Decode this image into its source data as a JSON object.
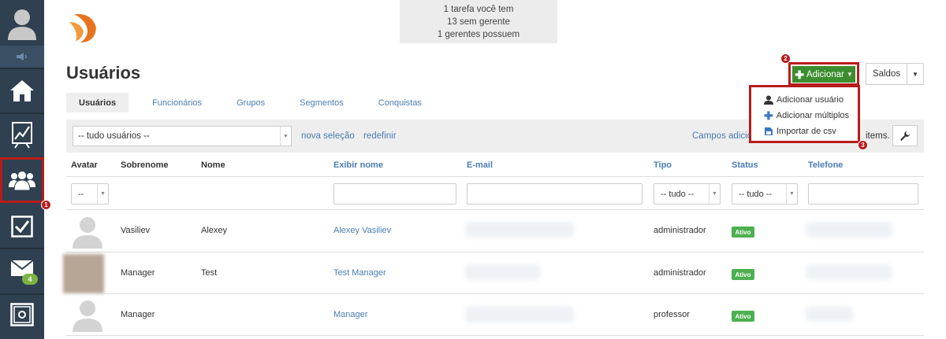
{
  "notification": {
    "line1": "1 tarefa você tem",
    "line2": "13 sem gerente",
    "line3": "1 gerentes possuem"
  },
  "page": {
    "title": "Usuários"
  },
  "toolbar": {
    "add_label": "Adicionar",
    "saldos_label": "Saldos"
  },
  "dropdown": {
    "items": [
      {
        "label": "Adicionar usuário",
        "icon": "user-icon"
      },
      {
        "label": "Adicionar múltiplos",
        "icon": "plus-icon"
      },
      {
        "label": "Importar de csv",
        "icon": "csv-import-icon"
      }
    ]
  },
  "tabs": [
    "Usuários",
    "Funcionários",
    "Grupos",
    "Segmentos",
    "Conquistas"
  ],
  "filterbar": {
    "selection": "-- tudo usuários --",
    "new_selection": "nova seleção",
    "reset": "redefinir",
    "custom_fields": "Campos adicio",
    "items": "items."
  },
  "table": {
    "headers": [
      "Avatar",
      "Sobrenome",
      "Nome",
      "Exibir nome",
      "E-mail",
      "Tipo",
      "Status",
      "Telefone"
    ],
    "filters": {
      "avatar": "--",
      "tipo": "-- tudo --",
      "status": "-- tudo --"
    },
    "rows": [
      {
        "sobrenome": "Vasiliev",
        "nome": "Alexey",
        "exibir": "Alexey Vasiliev",
        "tipo": "administrador",
        "status": "Ativo"
      },
      {
        "sobrenome": "Manager",
        "nome": "Test",
        "exibir": "Test Manager",
        "tipo": "administrador",
        "status": "Ativo"
      },
      {
        "sobrenome": "Manager",
        "nome": "",
        "exibir": "Manager",
        "tipo": "professor",
        "status": "Ativo"
      }
    ]
  },
  "sidebar": {
    "mail_count": "4"
  },
  "annotations": [
    "1",
    "2",
    "3"
  ],
  "colors": {
    "sidebar": "#2f4050",
    "accent_green": "#3c8d2f",
    "highlight_red": "#b71c1c",
    "link": "#4a7db5"
  }
}
